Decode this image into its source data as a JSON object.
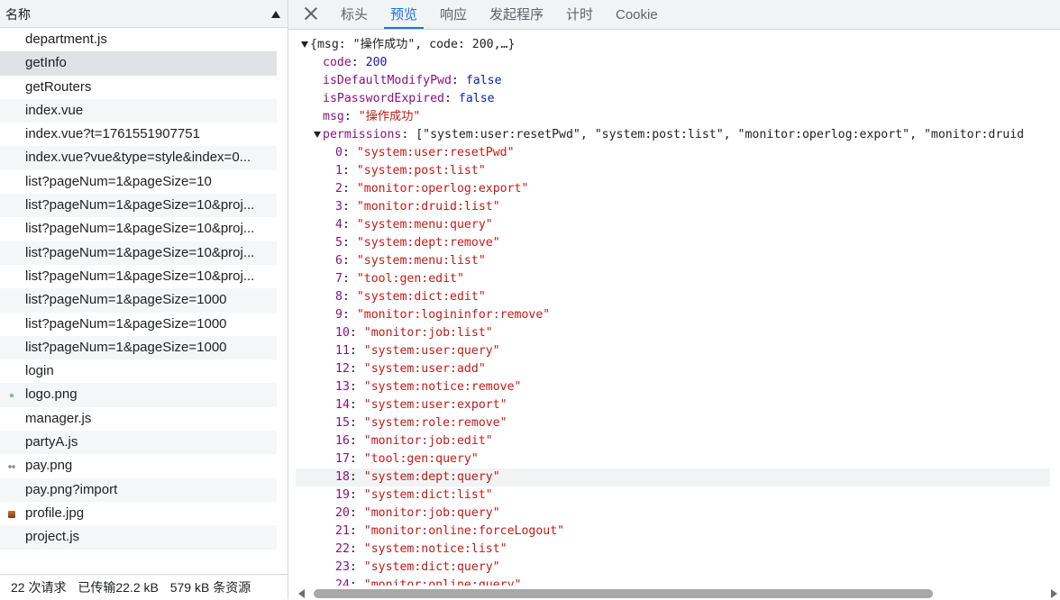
{
  "list": {
    "header": "名称",
    "rows": [
      {
        "name": "department.js"
      },
      {
        "name": "getInfo"
      },
      {
        "name": "getRouters"
      },
      {
        "name": "index.vue"
      },
      {
        "name": "index.vue?t=1761551907751"
      },
      {
        "name": "index.vue?vue&type=style&index=0..."
      },
      {
        "name": "list?pageNum=1&pageSize=10"
      },
      {
        "name": "list?pageNum=1&pageSize=10&proj..."
      },
      {
        "name": "list?pageNum=1&pageSize=10&proj..."
      },
      {
        "name": "list?pageNum=1&pageSize=10&proj..."
      },
      {
        "name": "list?pageNum=1&pageSize=10&proj..."
      },
      {
        "name": "list?pageNum=1&pageSize=1000"
      },
      {
        "name": "list?pageNum=1&pageSize=1000"
      },
      {
        "name": "list?pageNum=1&pageSize=1000"
      },
      {
        "name": "login"
      },
      {
        "name": "logo.png",
        "icon": "png-file-icon"
      },
      {
        "name": "manager.js"
      },
      {
        "name": "partyA.js"
      },
      {
        "name": "pay.png",
        "icon": "png-file-icon"
      },
      {
        "name": "pay.png?import"
      },
      {
        "name": "profile.jpg",
        "icon": "jpg-file-icon"
      },
      {
        "name": "project.js"
      }
    ],
    "selected_index": 1
  },
  "summary": {
    "requests": "22 次请求",
    "transferred": "已传输22.2 kB",
    "resources": "579 kB 条资源"
  },
  "tabs": [
    {
      "label": "标头"
    },
    {
      "label": "预览"
    },
    {
      "label": "响应"
    },
    {
      "label": "发起程序"
    },
    {
      "label": "计时"
    },
    {
      "label": "Cookie"
    }
  ],
  "active_tab": 1,
  "preview": {
    "root_summary": "{msg: \"操作成功\", code: 200,…}",
    "props": [
      {
        "key": "code",
        "value": "200",
        "kind": "number"
      },
      {
        "key": "isDefaultModifyPwd",
        "value": "false",
        "kind": "bool"
      },
      {
        "key": "isPasswordExpired",
        "value": "false",
        "kind": "bool"
      },
      {
        "key": "msg",
        "value": "\"操作成功\"",
        "kind": "string"
      }
    ],
    "permissions_key": "permissions",
    "permissions_summary": "[\"system:user:resetPwd\", \"system:post:list\", \"monitor:operlog:export\", \"monitor:druid",
    "permissions_items": [
      {
        "index": "0",
        "value": "\"system:user:resetPwd\""
      },
      {
        "index": "1",
        "value": "\"system:post:list\""
      },
      {
        "index": "2",
        "value": "\"monitor:operlog:export\""
      },
      {
        "index": "3",
        "value": "\"monitor:druid:list\""
      },
      {
        "index": "4",
        "value": "\"system:menu:query\""
      },
      {
        "index": "5",
        "value": "\"system:dept:remove\""
      },
      {
        "index": "6",
        "value": "\"system:menu:list\""
      },
      {
        "index": "7",
        "value": "\"tool:gen:edit\""
      },
      {
        "index": "8",
        "value": "\"system:dict:edit\""
      },
      {
        "index": "9",
        "value": "\"monitor:logininfor:remove\""
      },
      {
        "index": "10",
        "value": "\"monitor:job:list\""
      },
      {
        "index": "11",
        "value": "\"system:user:query\""
      },
      {
        "index": "12",
        "value": "\"system:user:add\""
      },
      {
        "index": "13",
        "value": "\"system:notice:remove\""
      },
      {
        "index": "14",
        "value": "\"system:user:export\""
      },
      {
        "index": "15",
        "value": "\"system:role:remove\""
      },
      {
        "index": "16",
        "value": "\"monitor:job:edit\""
      },
      {
        "index": "17",
        "value": "\"tool:gen:query\""
      },
      {
        "index": "18",
        "value": "\"system:dept:query\""
      },
      {
        "index": "19",
        "value": "\"system:dict:list\""
      },
      {
        "index": "20",
        "value": "\"monitor:job:query\""
      },
      {
        "index": "21",
        "value": "\"monitor:online:forceLogout\""
      },
      {
        "index": "22",
        "value": "\"system:notice:list\""
      },
      {
        "index": "23",
        "value": "\"system:dict:query\""
      },
      {
        "index": "24",
        "value": "\"monitor:online:query\""
      }
    ],
    "highlighted_item": 18
  },
  "colors": {
    "accent": "#1a73e8",
    "key": "#881280",
    "string": "#c41a16",
    "number": "#1a1aa6",
    "selected_row": "#dfe1e5"
  }
}
